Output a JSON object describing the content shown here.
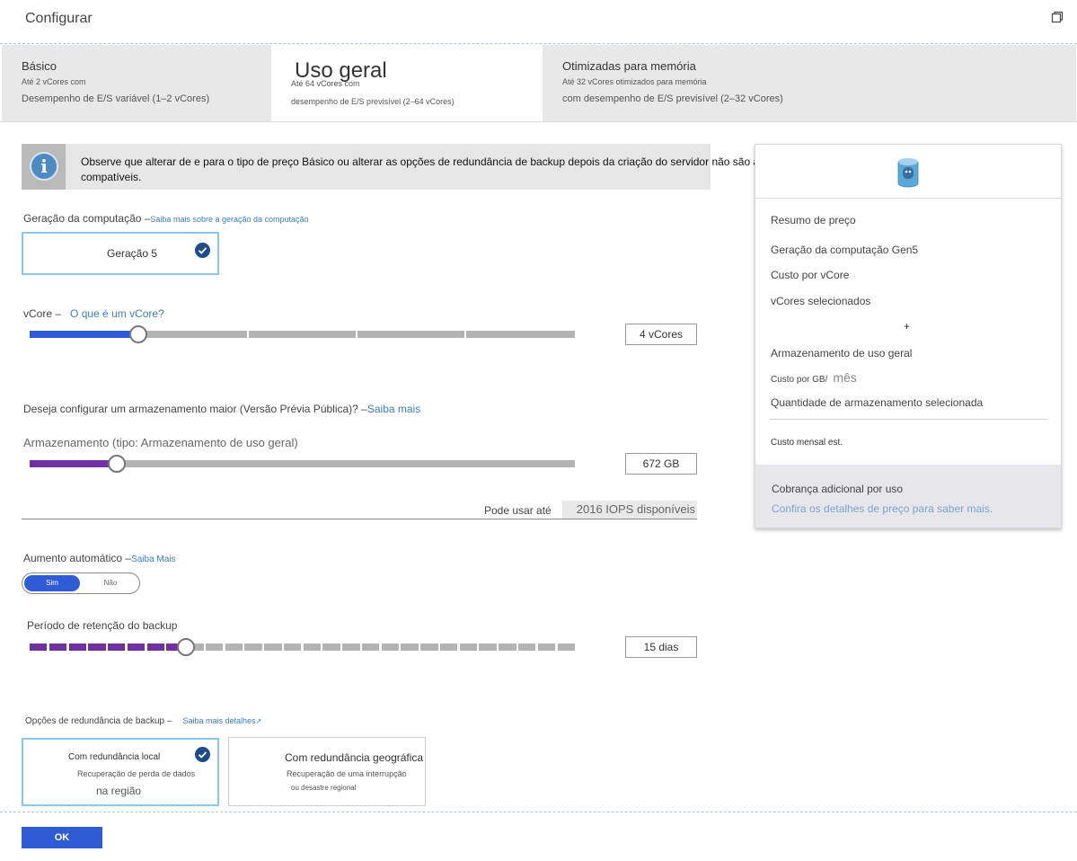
{
  "header": {
    "title": "Configurar",
    "restore_icon": "restore-window-icon"
  },
  "tiers": [
    {
      "title": "Básico",
      "line1": "Até 2 vCores com",
      "line2": "Desempenho de E/S variável (1–2 vCores)"
    },
    {
      "title": "Uso geral",
      "line1": "Até 64 vCores com",
      "line2": "desempenho de E/S previsível (2–64 vCores)"
    },
    {
      "title": "Otimizadas para memória",
      "line1": "Até 32 vCores otimizados para memória",
      "line2": "com desempenho de E/S previsível (2–32 vCores)"
    }
  ],
  "notice": {
    "icon": "info-icon",
    "glyph": "i",
    "text": "Observe que alterar de e para o tipo de preço Básico ou alterar as opções de redundância de backup depois da criação do servidor não são ações compatíveis."
  },
  "compute": {
    "label": "Geração da computação –",
    "link": "Saiba mais sobre a geração da computação",
    "option": "Geração 5"
  },
  "vcore": {
    "label": "vCore –",
    "link": "O que é um vCore?",
    "value": "4 vCores",
    "level": 0.2
  },
  "storage": {
    "question": "Deseja configurar um armazenamento maior (Versão Prévia Pública)? –",
    "question_link": "Saiba mais",
    "label": "Armazenamento (tipo: Armazenamento de uso geral)",
    "value": "672 GB",
    "level": 0.16,
    "iops_prefix": "Pode usar até",
    "iops_value": "2016 IOPS disponíveis"
  },
  "autogrow": {
    "label": "Aumento automático –",
    "link": "Saiba Mais",
    "yes": "Sim",
    "no": "Não"
  },
  "retention": {
    "label": "Período de retenção do backup",
    "value": "15 dias",
    "segments_total": 28,
    "segments_filled": 8
  },
  "redundancy": {
    "label": "Opções de redundância de backup –",
    "link": "Saiba mais detalhes",
    "local": {
      "title": "Com redundância local",
      "line1": "Recuperação de perda de dados",
      "line2": "na região"
    },
    "geo": {
      "title": "Com redundância geográfica",
      "line1": "Recuperação de uma interrupção",
      "line2": "ou desastre regional"
    }
  },
  "pricing": {
    "db_icon": "postgresql-database-icon",
    "summary": "Resumo de preço",
    "compute_gen": "Geração da computação Gen5",
    "cost_per_vcore": "Custo por vCore",
    "vcores_selected": "vCores selecionados",
    "plus": "+",
    "storage_title": "Armazenamento de uso geral",
    "cost_per_gb": "Custo por GB/",
    "cost_per_gb_unit": "mês",
    "storage_selected": "Quantidade de armazenamento selecionada",
    "monthly": "Custo mensal est.",
    "extra_title": "Cobrança adicional por uso",
    "extra_link": "Confira os detalhes de preço para saber mais."
  },
  "ok_button": "OK",
  "colors": {
    "accent": "#2f5bd6",
    "storage": "#7030a0",
    "retention": "#7030a0",
    "link": "#3b7fc2"
  }
}
